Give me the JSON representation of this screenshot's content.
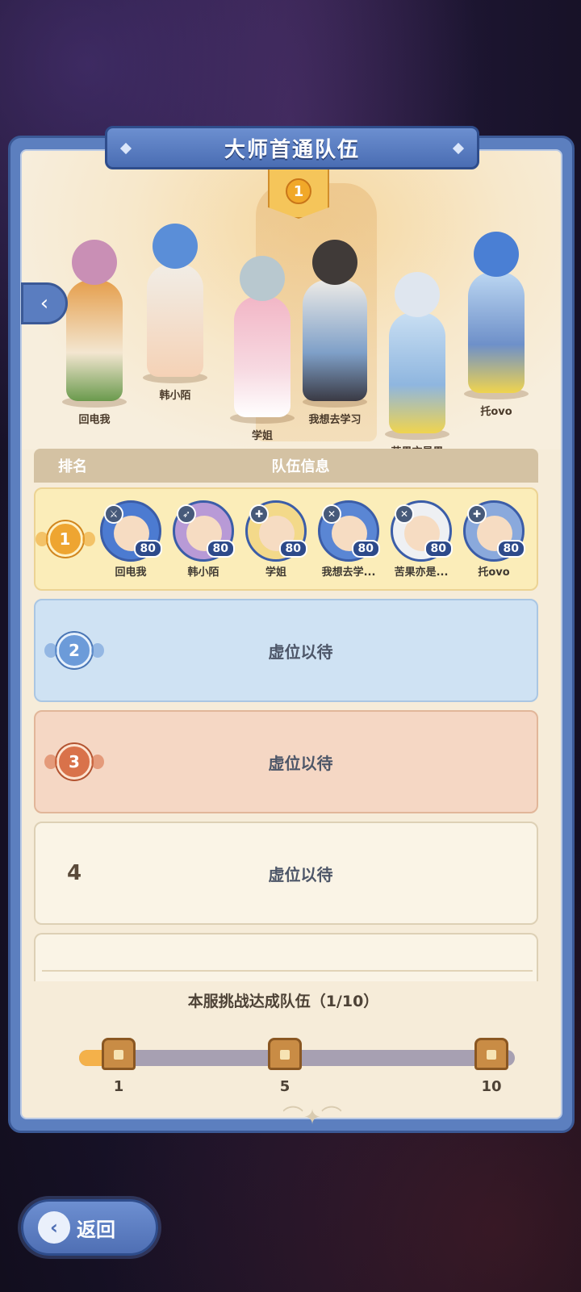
{
  "title": "大师首通队伍",
  "featured_rank": "1",
  "hero_characters": [
    {
      "name": "回电我"
    },
    {
      "name": "韩小陌"
    },
    {
      "name": "学姐"
    },
    {
      "name": "我想去学习"
    },
    {
      "name": "苦果亦是果"
    },
    {
      "name": "托ovo"
    }
  ],
  "list_header": {
    "rank": "排名",
    "team_info": "队伍信息"
  },
  "rank_rows": [
    {
      "rank": "1",
      "members": [
        {
          "name": "回电我",
          "level": "80",
          "class_icon": "sword-icon"
        },
        {
          "name": "韩小陌",
          "level": "80",
          "class_icon": "bow-icon"
        },
        {
          "name": "学姐",
          "level": "80",
          "class_icon": "cross-icon"
        },
        {
          "name": "我想去学...",
          "level": "80",
          "class_icon": "crossed-swords-icon"
        },
        {
          "name": "苦果亦是...",
          "level": "80",
          "class_icon": "crossed-swords-icon"
        },
        {
          "name": "托ovo",
          "level": "80",
          "class_icon": "cross-icon"
        }
      ]
    },
    {
      "rank": "2",
      "status": "虚位以待"
    },
    {
      "rank": "3",
      "status": "虚位以待"
    },
    {
      "rank": "4",
      "status": "虚位以待"
    }
  ],
  "progress": {
    "title": "本服挑战达成队伍（1/10）",
    "current": 1,
    "max": 10,
    "milestones": [
      "1",
      "5",
      "10"
    ]
  },
  "back_button": {
    "label": "返回"
  },
  "colors": {
    "panel_blue": "#5c7fbf",
    "gold": "#eea531",
    "silver": "#6c9bd9",
    "bronze": "#d9724a"
  }
}
